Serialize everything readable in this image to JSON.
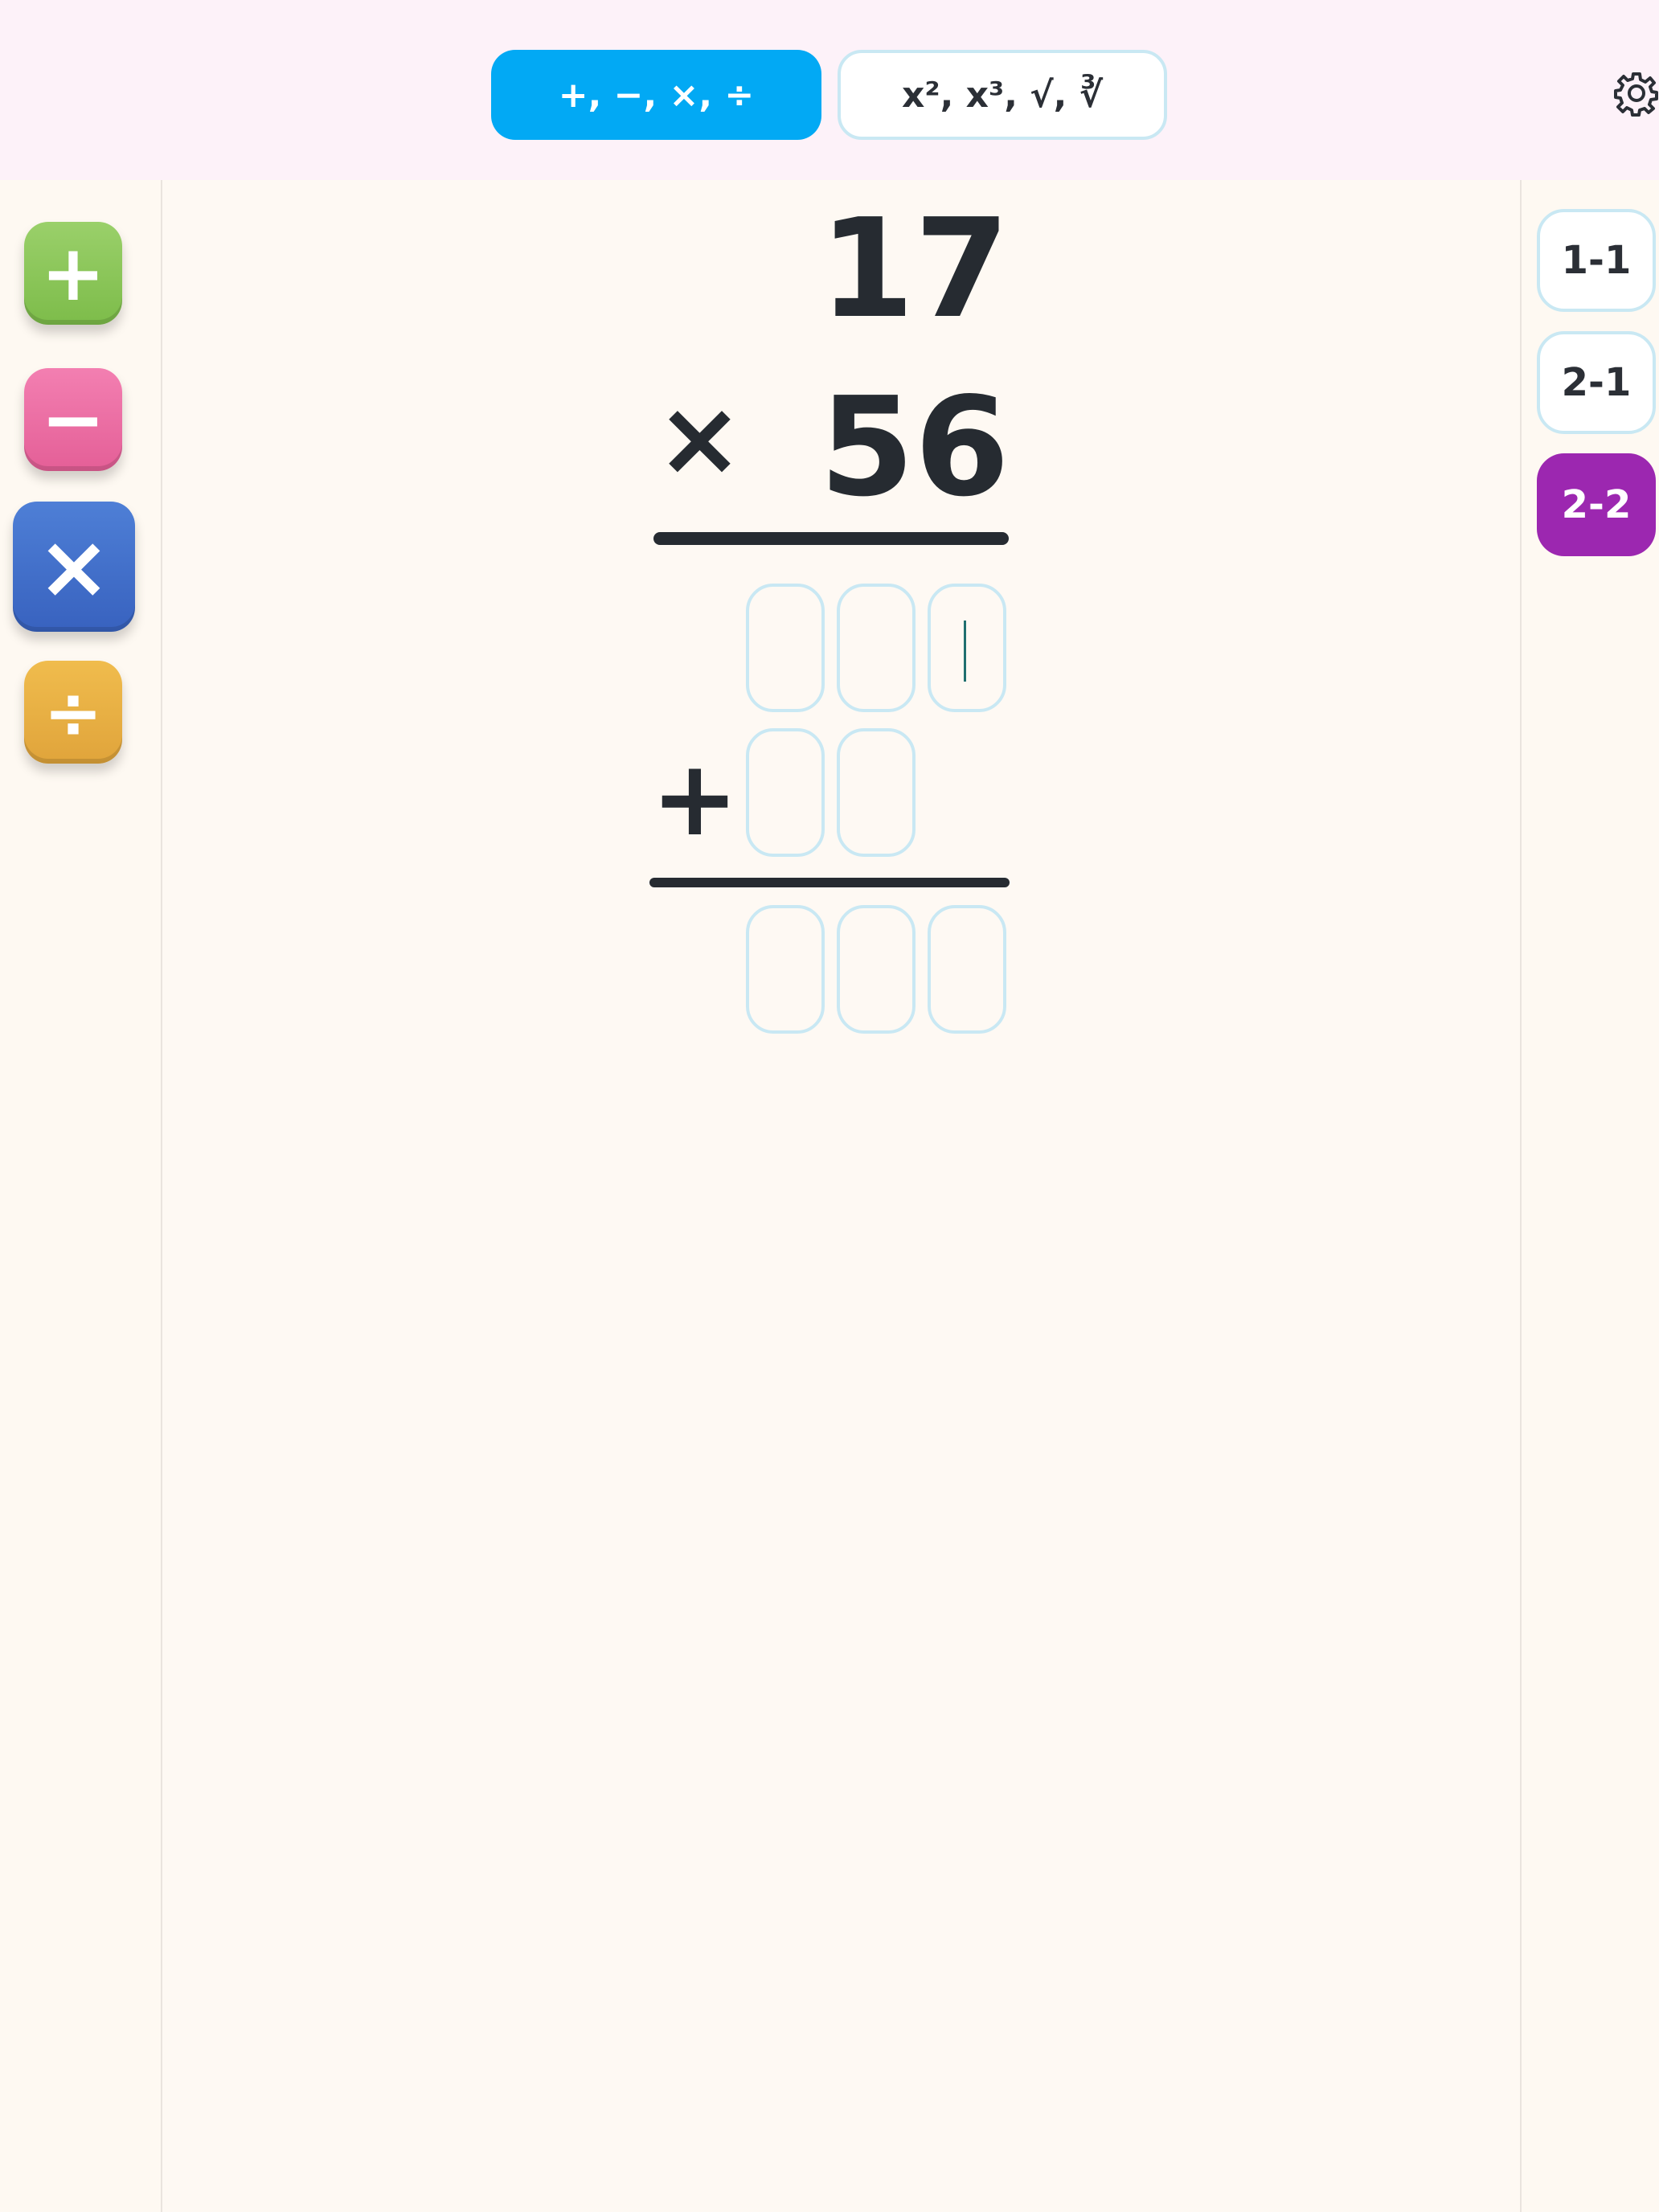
{
  "header": {
    "mode_tabs": [
      {
        "label": "+, −, ×, ÷",
        "active": true
      },
      {
        "label": "x², x³, √, ∛",
        "active": false
      }
    ],
    "settings_icon": "gear-icon"
  },
  "operations": [
    {
      "name": "add",
      "icon": "plus-icon",
      "symbol": "+",
      "color": "#8cc65a"
    },
    {
      "name": "subtract",
      "icon": "minus-icon",
      "symbol": "−",
      "color": "#ec6fa4"
    },
    {
      "name": "multiply",
      "icon": "times-icon",
      "symbol": "×",
      "color": "#4470cb",
      "selected": true
    },
    {
      "name": "divide",
      "icon": "divide-icon",
      "symbol": "÷",
      "color": "#e8b044"
    }
  ],
  "levels": [
    {
      "label": "1-1",
      "active": false
    },
    {
      "label": "2-1",
      "active": false
    },
    {
      "label": "2-2",
      "active": true
    }
  ],
  "problem": {
    "multiplicand": "17",
    "multiplier": "56",
    "operator": "×",
    "addition_operator": "+",
    "partial_product_1": [
      "",
      "",
      ""
    ],
    "partial_product_2": [
      "",
      ""
    ],
    "result": [
      "",
      "",
      ""
    ]
  },
  "colors": {
    "accent_blue": "#02a9f4",
    "active_level_purple": "#9c27b0",
    "cell_border": "#c9e8f3"
  }
}
